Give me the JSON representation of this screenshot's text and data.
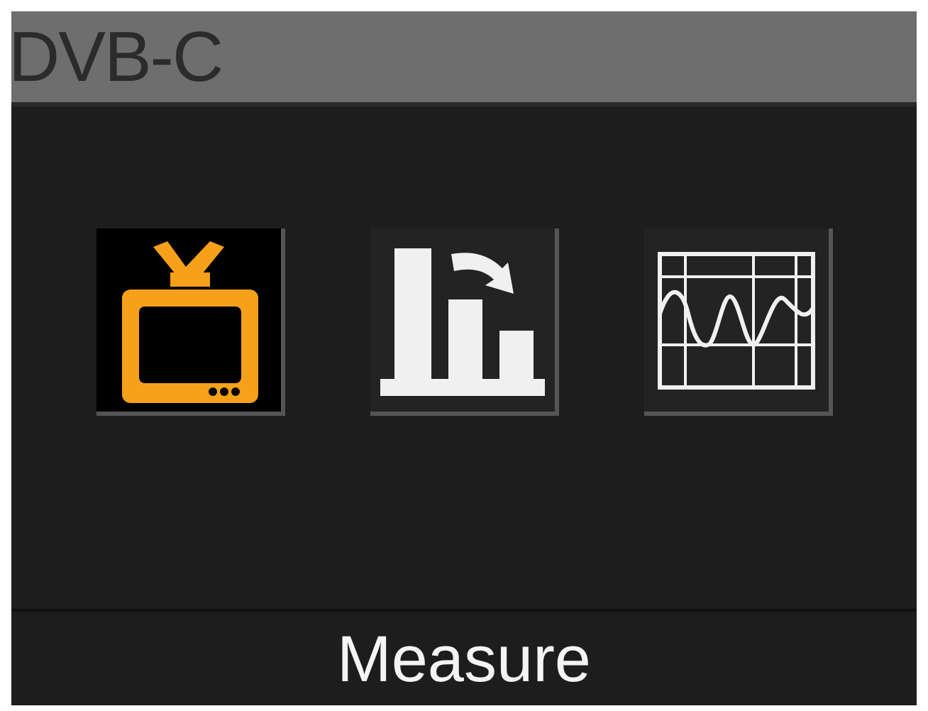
{
  "header": {
    "title": "DVB-C"
  },
  "menu_items": [
    {
      "kind": "tv",
      "selected": true
    },
    {
      "kind": "bars",
      "selected": false
    },
    {
      "kind": "scope",
      "selected": false
    }
  ],
  "footer": {
    "label": "Measure"
  }
}
